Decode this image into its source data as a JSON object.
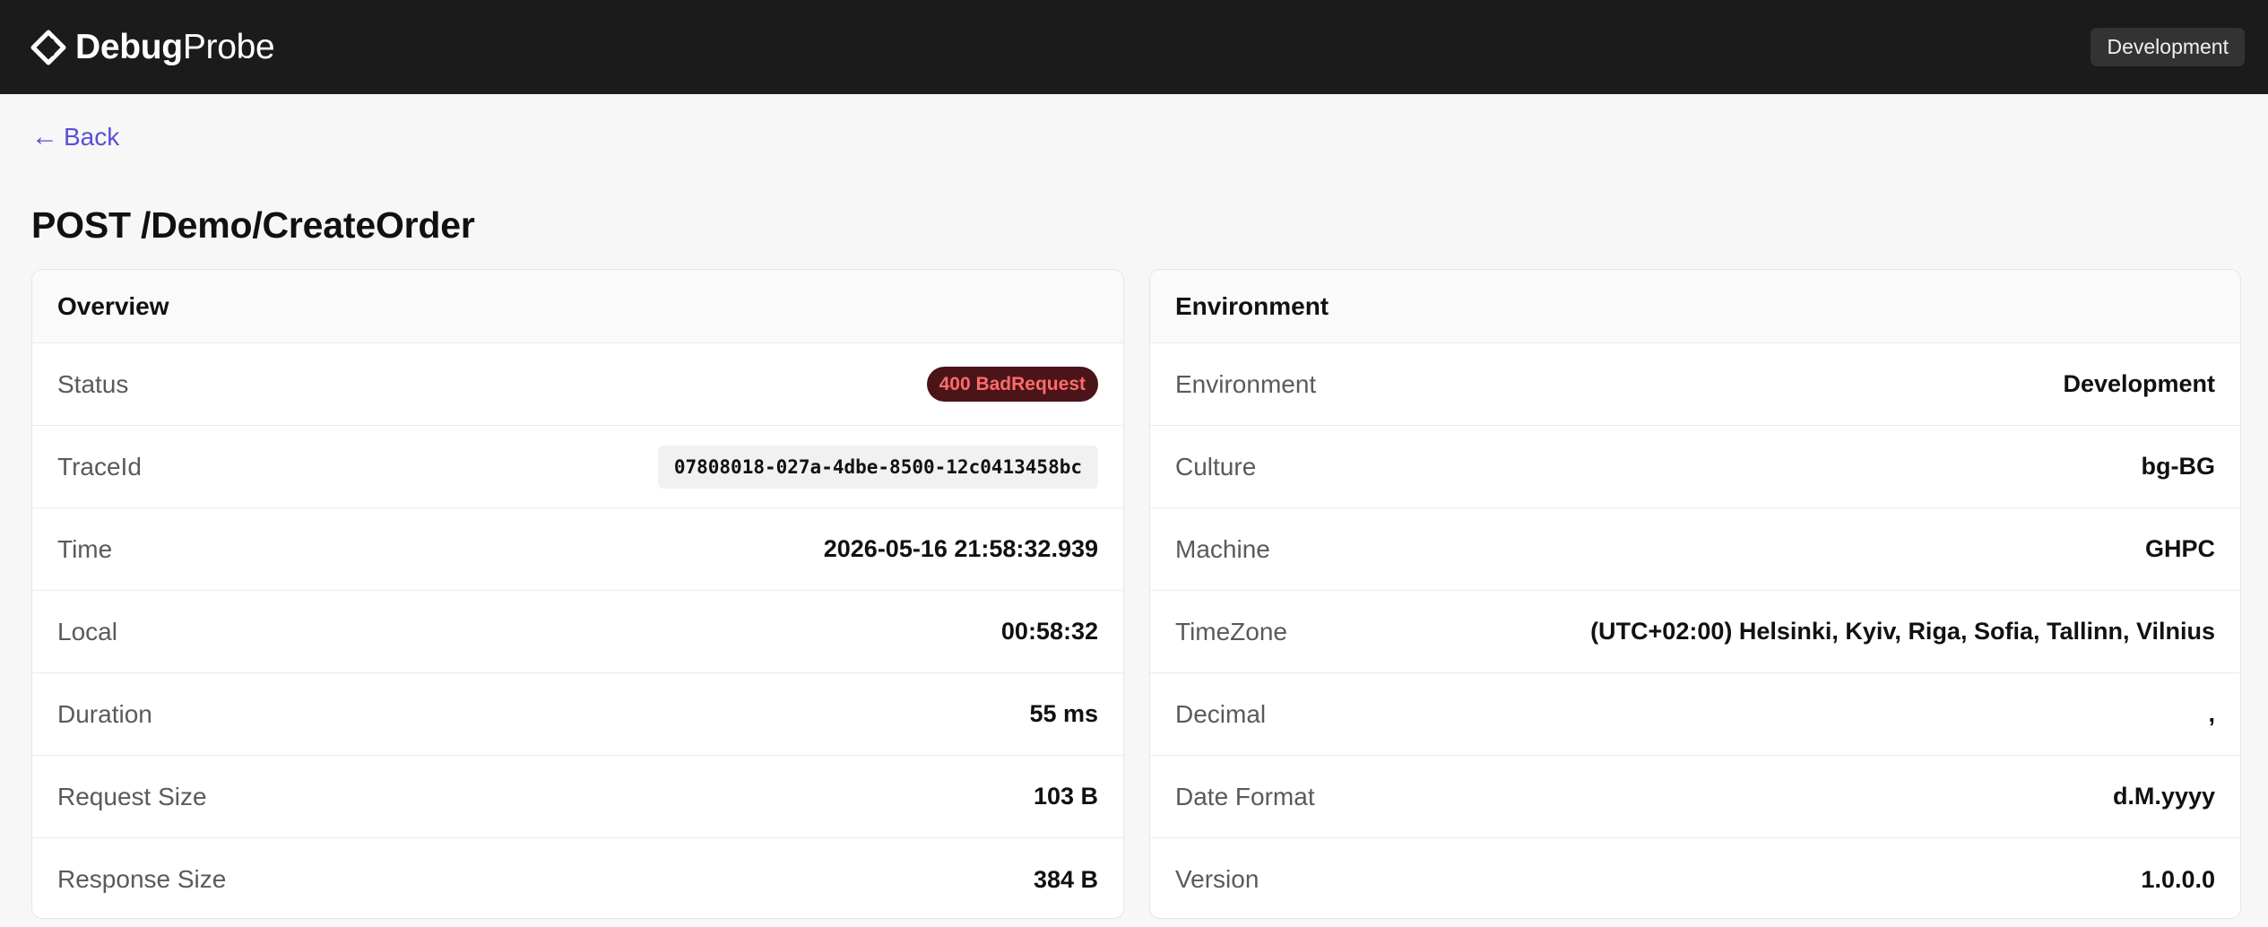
{
  "header": {
    "brand_strong": "Debug",
    "brand_light": "Probe",
    "environment_badge": "Development"
  },
  "nav": {
    "back_arrow": "←",
    "back_label": "Back"
  },
  "page": {
    "title": "POST /Demo/CreateOrder"
  },
  "overview": {
    "title": "Overview",
    "rows": [
      {
        "label": "Status",
        "value": "400 BadRequest"
      },
      {
        "label": "TraceId",
        "value": "07808018-027a-4dbe-8500-12c0413458bc"
      },
      {
        "label": "Time",
        "value": "2026-05-16 21:58:32.939"
      },
      {
        "label": "Local",
        "value": "00:58:32"
      },
      {
        "label": "Duration",
        "value": "55 ms"
      },
      {
        "label": "Request Size",
        "value": "103 B"
      },
      {
        "label": "Response Size",
        "value": "384 B"
      }
    ]
  },
  "environment": {
    "title": "Environment",
    "rows": [
      {
        "label": "Environment",
        "value": "Development"
      },
      {
        "label": "Culture",
        "value": "bg-BG"
      },
      {
        "label": "Machine",
        "value": "GHPC"
      },
      {
        "label": "TimeZone",
        "value": "(UTC+02:00) Helsinki, Kyiv, Riga, Sofia, Tallinn, Vilnius"
      },
      {
        "label": "Decimal",
        "value": ","
      },
      {
        "label": "Date Format",
        "value": "d.M.yyyy"
      },
      {
        "label": "Version",
        "value": "1.0.0.0"
      }
    ]
  },
  "colors": {
    "topbar_bg": "#1b1b1b",
    "link": "#5b4fd6",
    "status_error_bg": "#4a1418",
    "status_error_text": "#ff6b6b"
  },
  "icons": {
    "brand_logo": "diamond-chevron-icon"
  }
}
